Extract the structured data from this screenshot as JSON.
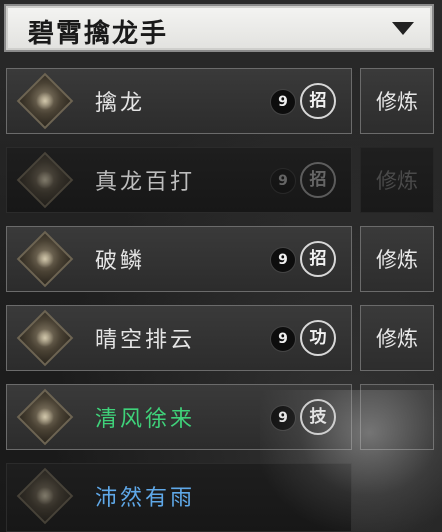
{
  "title": {
    "text": "碧霄擒龙手",
    "arrow_icon": "triangle-down"
  },
  "skills": [
    {
      "name": "擒龙",
      "level": "9",
      "type": "招",
      "button": "修炼",
      "locked": false,
      "name_color": "#e4e4e4"
    },
    {
      "name": "真龙百打",
      "level": "9",
      "type": "招",
      "button": "修炼",
      "locked": true,
      "name_color": "#bdbdbd"
    },
    {
      "name": "破鳞",
      "level": "9",
      "type": "招",
      "button": "修炼",
      "locked": false,
      "name_color": "#e4e4e4"
    },
    {
      "name": "晴空排云",
      "level": "9",
      "type": "功",
      "button": "修炼",
      "locked": false,
      "name_color": "#e4e4e4"
    },
    {
      "name": "清风徐来",
      "level": "9",
      "type": "技",
      "button": "",
      "locked": false,
      "name_color": "#3fd27a"
    },
    {
      "name": "沛然有雨",
      "level": "",
      "type": "",
      "button": "",
      "locked": true,
      "name_color": "#5fa8e8"
    }
  ]
}
